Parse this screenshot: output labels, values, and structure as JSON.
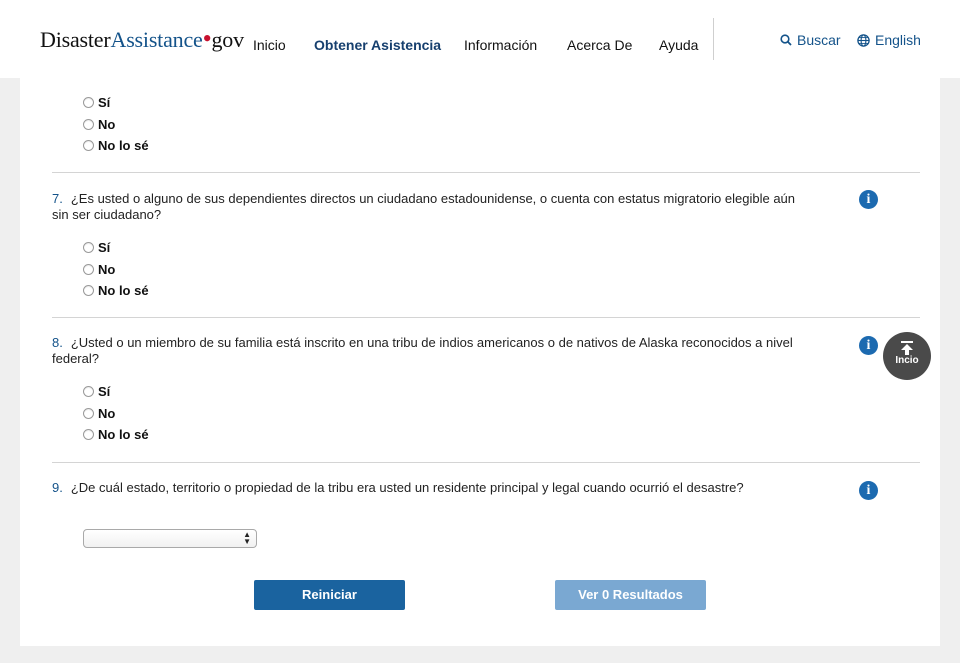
{
  "header": {
    "logo": {
      "part1": "Disaster",
      "part2": "Assistance",
      "dot": "•",
      "part3": "gov"
    },
    "nav": [
      {
        "label": "Inicio",
        "active": false
      },
      {
        "label": "Obtener Asistencia",
        "active": true
      },
      {
        "label": "Información",
        "active": false
      },
      {
        "label": "Acerca De",
        "active": false
      },
      {
        "label": "Ayuda",
        "active": false
      }
    ],
    "search": {
      "label": "Buscar",
      "icon": "search-icon"
    },
    "language": {
      "label": "English",
      "icon": "globe-icon"
    }
  },
  "top_options": [
    "Sí",
    "No",
    "No lo sé"
  ],
  "questions": [
    {
      "number": "7.",
      "text": "¿Es usted o alguno de sus dependientes directos un ciudadano estadounidense, o cuenta con estatus migratorio elegible aún sin ser ciudadano?",
      "options": [
        "Sí",
        "No",
        "No lo sé"
      ]
    },
    {
      "number": "8.",
      "text": "¿Usted o un miembro de su familia está inscrito en una tribu de indios americanos o de nativos de Alaska reconocidos a nivel federal?",
      "options": [
        "Sí",
        "No",
        "No lo sé"
      ]
    },
    {
      "number": "9.",
      "text": "¿De cuál estado, territorio o propiedad de la tribu era usted un residente principal y legal cuando ocurrió el desastre?",
      "select_value": ""
    }
  ],
  "info_icon_glyph": "i",
  "buttons": {
    "reset": "Reiniciar",
    "results": "Ver 0 Resultados"
  },
  "back_to_top": {
    "label": "Incio"
  },
  "colors": {
    "brand_blue": "#1a639f",
    "disabled_blue": "#7aa8d2",
    "accent_red": "#c8102e"
  }
}
